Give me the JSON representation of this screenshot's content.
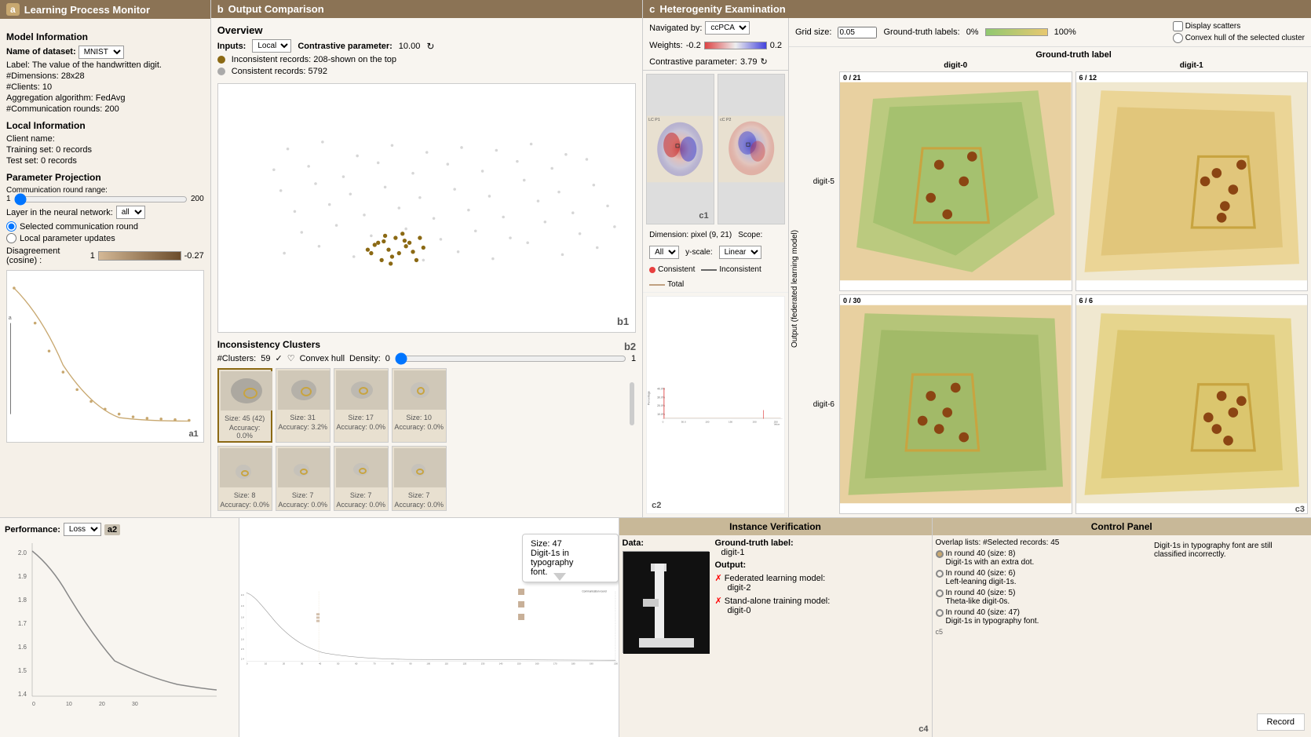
{
  "app": {
    "title": "Learning Process Monitor",
    "badge_a": "a",
    "badge_b": "b",
    "badge_c": "c"
  },
  "panel_a": {
    "header": "Learning Process Monitor",
    "model_info_title": "Model Information",
    "dataset_label": "Name of dataset:",
    "dataset_value": "MNIST",
    "label_text": "Label: The value of the handwritten digit.",
    "dimensions": "#Dimensions: 28x28",
    "clients": "#Clients: 10",
    "aggregation": "Aggregation algorithm: FedAvg",
    "comm_rounds": "#Communication rounds: 200",
    "local_info_title": "Local Information",
    "client_name": "Client name:",
    "training_set": "Training set: 0 records",
    "test_set": "Test set: 0 records",
    "param_proj_title": "Parameter Projection",
    "comm_range_label": "Communication round range:",
    "comm_range_min": "1",
    "comm_range_max": "200",
    "layer_label": "Layer in the neural network:",
    "layer_value": "all",
    "radio1": "Selected communication round",
    "radio2": "Local parameter updates",
    "disagreement_label": "Disagreement (cosine) :",
    "disagreement_min": "1",
    "disagreement_max": "-0.27",
    "a1_label": "a1",
    "perf_label": "Performance:",
    "perf_value": "Loss",
    "a2_label": "a2"
  },
  "panel_b": {
    "header": "Output Comparison",
    "overview_title": "Overview",
    "inputs_label": "Inputs:",
    "inputs_value": "Local",
    "contrastive_label": "Contrastive parameter:",
    "contrastive_value": "10.00",
    "inconsistent_label": "Inconsistent records: 208-shown on the top",
    "consistent_label": "Consistent records: 5792",
    "b1_label": "b1",
    "inconsistency_title": "Inconsistency Clusters",
    "clusters_label": "#Clusters:",
    "clusters_value": "59",
    "convex_hull_label": "Convex hull",
    "density_label": "Density:",
    "density_min": "0",
    "density_max": "1",
    "thumbnails": [
      {
        "size": "Size: 45 (42)",
        "accuracy": "Accuracy: 0.0%"
      },
      {
        "size": "Size: 31",
        "accuracy": "Accuracy: 3.2%"
      },
      {
        "size": "Size: 17",
        "accuracy": "Accuracy: 0.0%"
      },
      {
        "size": "Size: 10",
        "accuracy": "Accuracy: 0.0%"
      },
      {
        "size": "Size: 8",
        "accuracy": "Accuracy: 0.0%"
      },
      {
        "size": "Size: 7",
        "accuracy": "Accuracy: 0.0%"
      },
      {
        "size": "Size: 7",
        "accuracy": "Accuracy: 0.0%"
      },
      {
        "size": "Size: 7",
        "accuracy": "Accuracy: 0.0%"
      }
    ],
    "b2_label": "b2"
  },
  "panel_c_viz": {
    "navigated_by_label": "Navigated by:",
    "navigated_by_value": "ccPCA",
    "weights_label": "Weights:",
    "weights_min": "-0.2",
    "weights_max": "0.2",
    "contrastive_label": "Contrastive parameter:",
    "contrastive_value": "3.79",
    "dimension_label": "Dimension: pixel (9, 21)",
    "scope_label": "Scope:",
    "scope_value": "All",
    "yscale_label": "y-scale:",
    "yscale_value": "Linear",
    "legend_consistent": "Consistent",
    "legend_inconsistent": "Inconsistent",
    "legend_total": "Total",
    "percentage_label": "Percentage",
    "chart_values": [
      "40.0%",
      "30.0%",
      "20.0%",
      "10.0%"
    ],
    "x_values": [
      "0",
      "50.0",
      "100",
      "150",
      "200",
      "250"
    ],
    "x_label": "Value",
    "c1_label": "c1",
    "c2_label": "c2"
  },
  "panel_c_hetero": {
    "header": "Heterogenity Examination",
    "grid_size_label": "Grid size:",
    "grid_size_value": "0.05",
    "truth_label": "Ground-truth labels:",
    "truth_min": "0%",
    "truth_max": "100%",
    "display_scatters": "Display scatters",
    "convex_hull": "Convex hull of the selected cluster",
    "ground_truth_col_label": "Ground-truth label",
    "col1": "digit-0",
    "col2": "digit-1",
    "row1": "digit-5",
    "row2": "digit-6",
    "output_label": "Output (federated learning model)",
    "cells": [
      {
        "pos": "0/21",
        "row": "digit-5",
        "col": "digit-0"
      },
      {
        "pos": "6/12",
        "row": "digit-5",
        "col": "digit-1"
      },
      {
        "pos": "0/30",
        "row": "digit-6",
        "col": "digit-0"
      },
      {
        "pos": "6/6",
        "row": "digit-6",
        "col": "digit-1"
      }
    ],
    "c3_label": "c3"
  },
  "instance_panel": {
    "header": "Instance Verification",
    "data_label": "Data:",
    "ground_truth_label": "Ground-truth label:",
    "ground_truth_value": "digit-1",
    "output_label": "Output:",
    "federated_label": "Federated learning model:",
    "federated_value": "digit-2",
    "standalone_label": "Stand-alone training model:",
    "standalone_value": "digit-0",
    "c4_label": "c4"
  },
  "control_panel": {
    "header": "Control Panel",
    "overlap_title": "Overlap lists:",
    "selected_records": "#Selected records: 45",
    "items": [
      {
        "label": "In round 40 (size: 8)",
        "sub": "Digit-1s with an extra dot."
      },
      {
        "label": "In round 40 (size: 6)",
        "sub": "Left-leaning digit-1s."
      },
      {
        "label": "In round 40 (size: 5)",
        "sub": "Theta-like digit-0s."
      },
      {
        "label": "In round 40 (size: 47)",
        "sub": "Digit-1s in typography font."
      }
    ],
    "note": "Digit-1s in typography font are still classified incorrectly.",
    "record_btn": "Record",
    "c5_label": "c5"
  },
  "bottom_chart": {
    "perf_label": "Performance:",
    "perf_value": "Loss",
    "comm_round_label": "Communication round",
    "comm_round_end": "200",
    "y_values": [
      "2.0",
      "1.9",
      "1.8",
      "1.7",
      "1.6",
      "1.5",
      "1.4"
    ],
    "x_values": [
      "0",
      "10",
      "20",
      "30",
      "40",
      "50",
      "60",
      "70",
      "80",
      "90",
      "100",
      "110",
      "120",
      "130",
      "140",
      "150",
      "160",
      "170",
      "180",
      "190",
      "200"
    ],
    "tooltip_text": "Size: 47\nDigit-1s in typography font.",
    "tooltip_line1": "Size: 47",
    "tooltip_line2": "Digit-1s in typography",
    "tooltip_line3": "font."
  }
}
